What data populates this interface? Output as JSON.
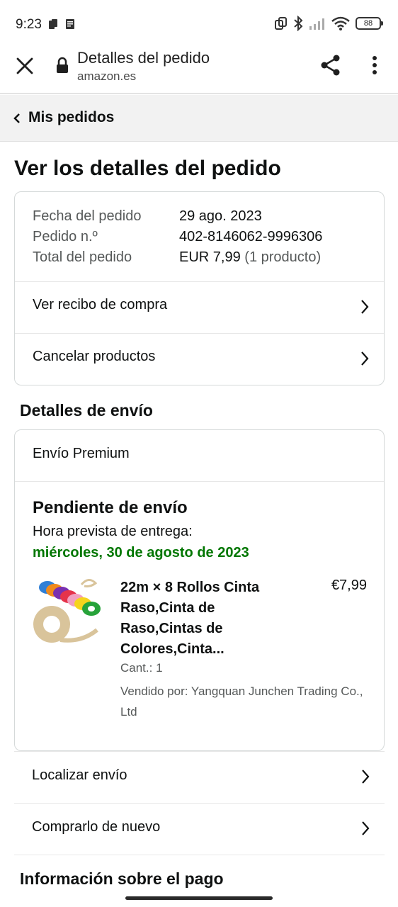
{
  "status_bar": {
    "time": "9:23",
    "battery": "88"
  },
  "browser": {
    "title": "Detalles del pedido",
    "url": "amazon.es"
  },
  "back_link": {
    "label": "Mis pedidos"
  },
  "page_title": "Ver los detalles del pedido",
  "order_summary": {
    "date_label": "Fecha del pedido",
    "date_value": "29 ago. 2023",
    "number_label": "Pedido n.º",
    "number_value": "402-8146062-9996306",
    "total_label": "Total del pedido",
    "total_value": "EUR 7,99",
    "total_count": "(1 producto)",
    "actions": [
      {
        "label": "Ver recibo de compra"
      },
      {
        "label": "Cancelar productos"
      }
    ]
  },
  "shipping": {
    "heading": "Detalles de envío",
    "method": "Envío Premium",
    "status": "Pendiente de envío",
    "eta_label": "Hora prevista de entrega:",
    "eta_date": "miércoles, 30 de agosto de 2023",
    "eta_color": "#007600",
    "product": {
      "title": "22m × 8 Rollos Cinta Raso,Cinta de Raso,Cintas de Colores,Cinta...",
      "price": "€7,99",
      "quantity": "Cant.: 1",
      "seller": "Vendido por: Yangquan Junchen Trading Co., Ltd",
      "image_icon": "ribbon-rolls-image"
    }
  },
  "shipment_actions": [
    {
      "label": "Localizar envío"
    },
    {
      "label": "Comprarlo de nuevo"
    }
  ],
  "payment": {
    "heading": "Información sobre el pago"
  }
}
